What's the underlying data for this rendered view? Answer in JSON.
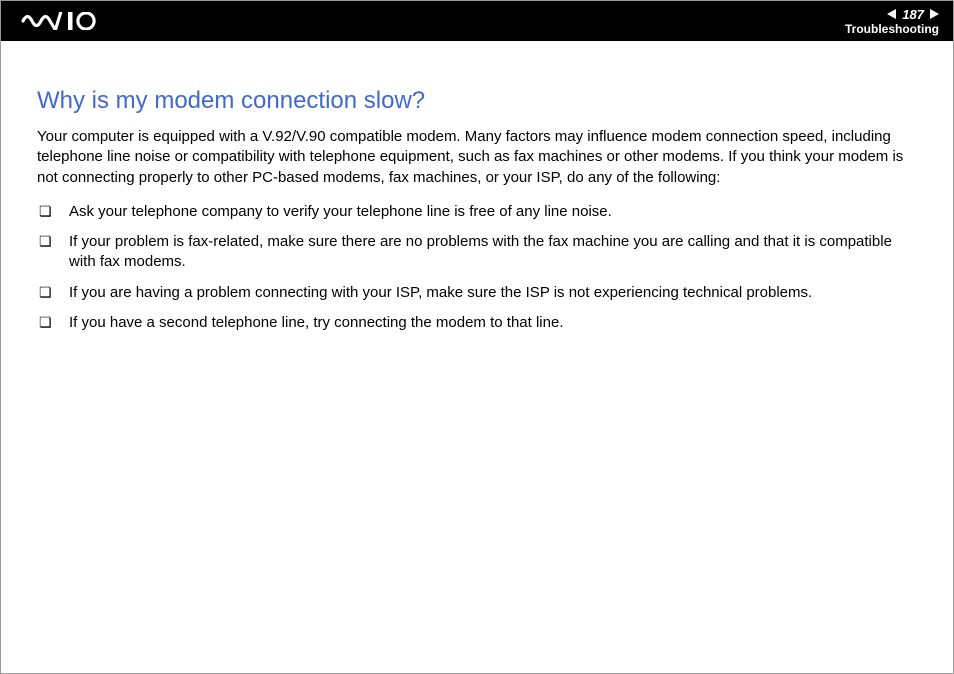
{
  "header": {
    "page_number": "187",
    "section": "Troubleshooting"
  },
  "content": {
    "title": "Why is my modem connection slow?",
    "intro": "Your computer is equipped with a V.92/V.90 compatible modem. Many factors may influence modem connection speed, including telephone line noise or compatibility with telephone equipment, such as fax machines or other modems. If you think your modem is not connecting properly to other PC-based modems, fax machines, or your ISP, do any of the following:",
    "bullets": [
      "Ask your telephone company to verify your telephone line is free of any line noise.",
      "If your problem is fax-related, make sure there are no problems with the fax machine you are calling and that it is compatible with fax modems.",
      "If you are having a problem connecting with your ISP, make sure the ISP is not experiencing technical problems.",
      "If you have a second telephone line, try connecting the modem to that line."
    ]
  }
}
